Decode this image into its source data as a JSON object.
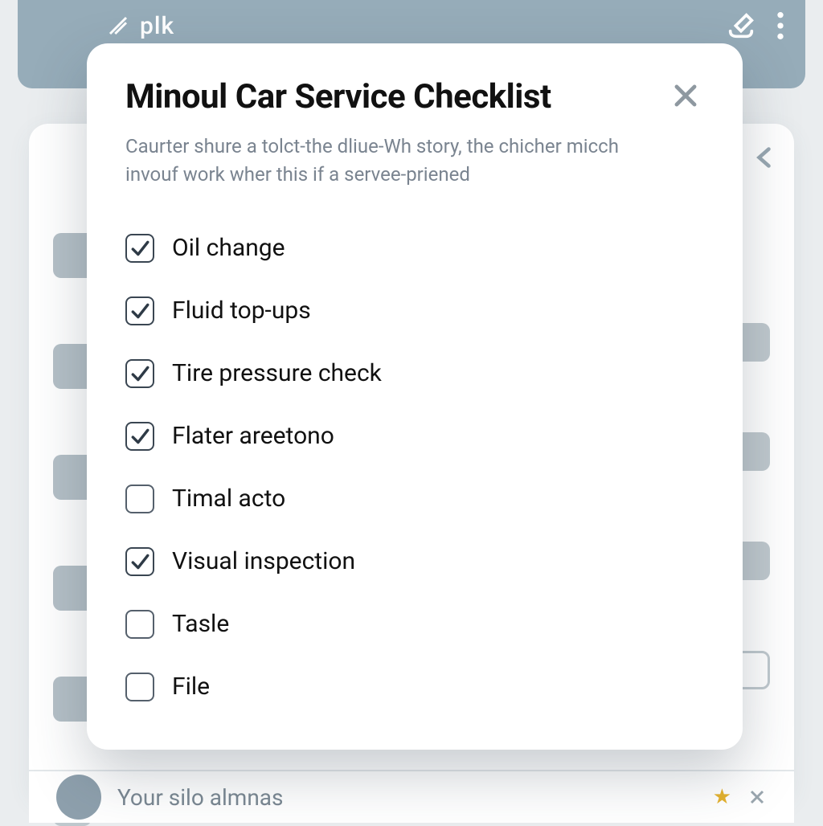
{
  "header": {
    "brand": "plk"
  },
  "modal": {
    "title": "Minoul Car Service Checklist",
    "subtitle": "Caurter shure a tolct-the dliue-Wh story, the chicher micch invouf work wher this if a servee-priened",
    "items": [
      {
        "label": "Oil change",
        "checked": true
      },
      {
        "label": "Fluid top-ups",
        "checked": true
      },
      {
        "label": "Tire pressure check",
        "checked": true
      },
      {
        "label": "Flater areetono",
        "checked": true
      },
      {
        "label": "Timal acto",
        "checked": false
      },
      {
        "label": "Visual inspection",
        "checked": true
      },
      {
        "label": "Tasle",
        "checked": false
      },
      {
        "label": "File",
        "checked": false
      }
    ]
  },
  "bottombar": {
    "text": "Your silo almnas"
  }
}
